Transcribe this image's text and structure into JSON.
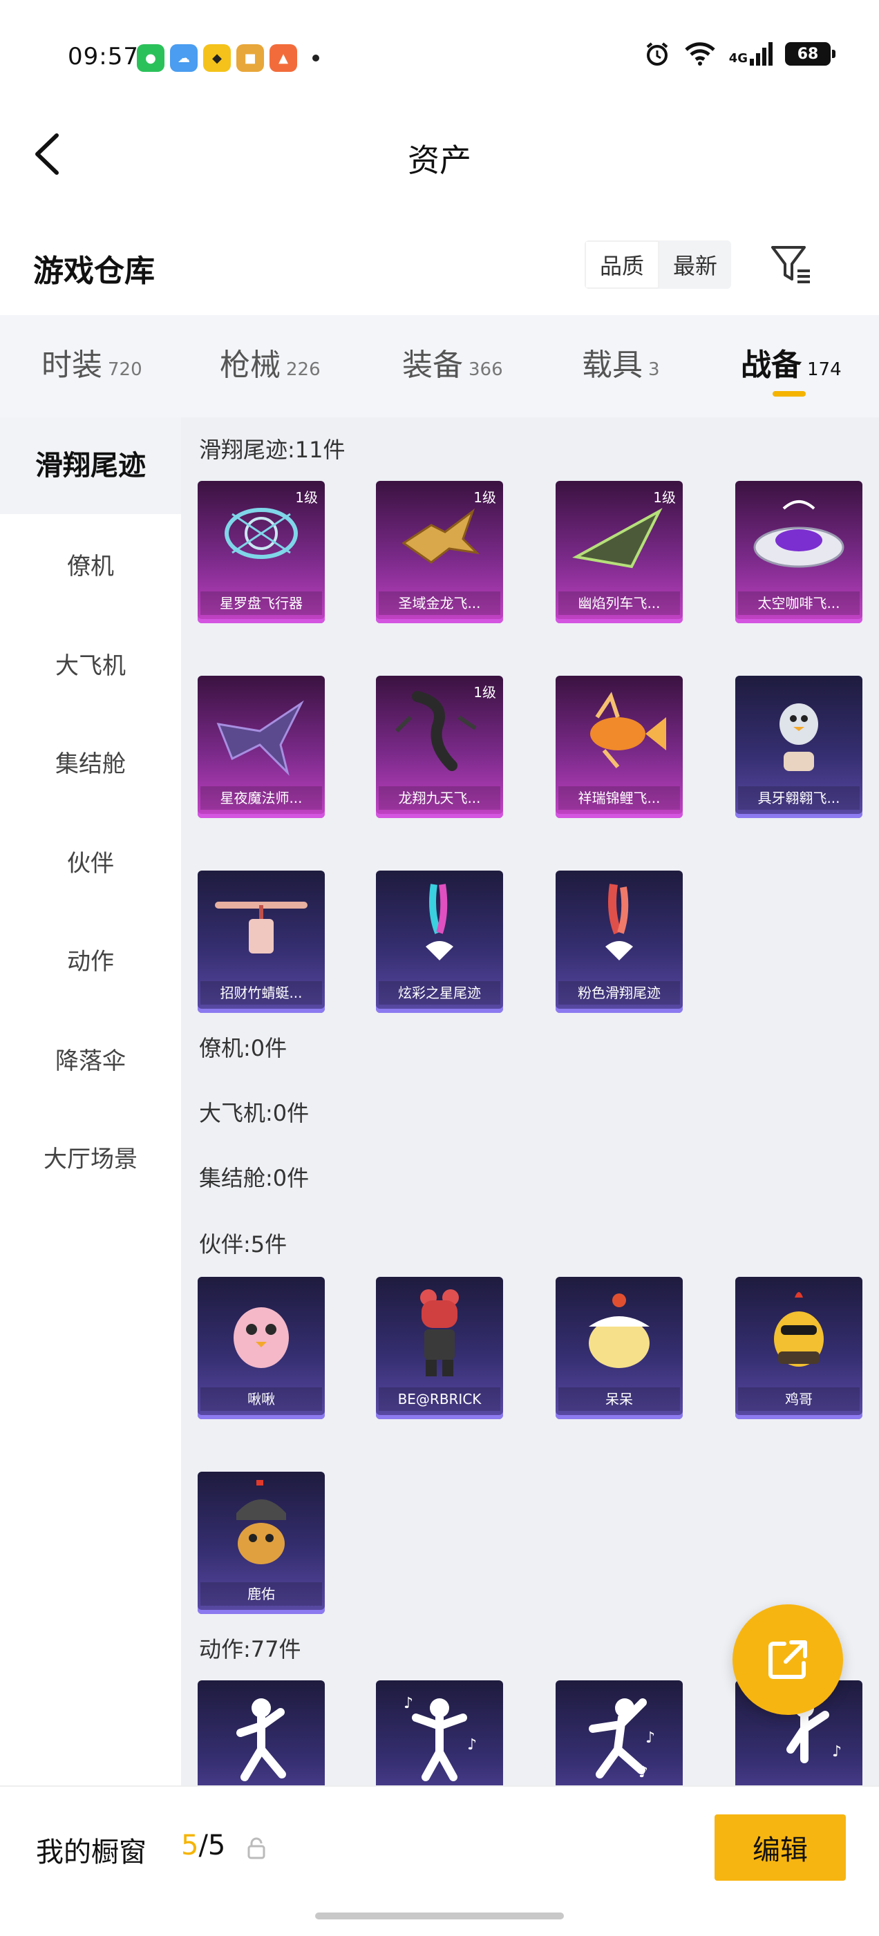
{
  "status_bar": {
    "time": "09:57",
    "network": "4G",
    "battery": "68",
    "icons": [
      "wechat-icon",
      "weather-icon",
      "qq-icon",
      "game-icon",
      "game2-icon",
      "alarm-icon",
      "wifi-icon",
      "signal-icon"
    ]
  },
  "header": {
    "title": "资产"
  },
  "warehouse": {
    "title": "游戏仓库",
    "sort_quality": "品质",
    "sort_newest": "最新"
  },
  "tabs": [
    {
      "label": "时装",
      "count": "720"
    },
    {
      "label": "枪械",
      "count": "226"
    },
    {
      "label": "装备",
      "count": "366"
    },
    {
      "label": "载具",
      "count": "3"
    },
    {
      "label": "战备",
      "count": "174"
    }
  ],
  "sidenav": [
    "滑翔尾迹",
    "僚机",
    "大飞机",
    "集结舱",
    "伙伴",
    "动作",
    "降落伞",
    "大厅场景"
  ],
  "sections": {
    "glide": {
      "title": "滑翔尾迹:11件",
      "items": [
        {
          "name": "星罗盘飞行器",
          "level": "1级"
        },
        {
          "name": "圣域金龙飞...",
          "level": "1级"
        },
        {
          "name": "幽焰列车飞...",
          "level": "1级"
        },
        {
          "name": "太空咖啡飞..."
        },
        {
          "name": "星夜魔法师..."
        },
        {
          "name": "龙翔九天飞...",
          "level": "1级"
        },
        {
          "name": "祥瑞锦鲤飞..."
        },
        {
          "name": "具牙翱翱飞..."
        },
        {
          "name": "招财竹蜻蜓..."
        },
        {
          "name": "炫彩之星尾迹"
        },
        {
          "name": "粉色滑翔尾迹"
        }
      ]
    },
    "wingman": {
      "title": "僚机:0件"
    },
    "plane": {
      "title": "大飞机:0件"
    },
    "pod": {
      "title": "集结舱:0件"
    },
    "partner": {
      "title": "伙伴:5件",
      "items": [
        {
          "name": "啾啾"
        },
        {
          "name": "BE@RBRICK"
        },
        {
          "name": "呆呆"
        },
        {
          "name": "鸡哥"
        },
        {
          "name": "鹿佑"
        }
      ]
    },
    "action": {
      "title": "动作:77件"
    }
  },
  "bottom": {
    "label": "我的橱窗",
    "count_current": "5",
    "count_total": "/5",
    "edit": "编辑"
  },
  "colors": {
    "accent": "#f7b511",
    "purple_card": "#7b2a8a",
    "blue_card": "#352e70"
  }
}
